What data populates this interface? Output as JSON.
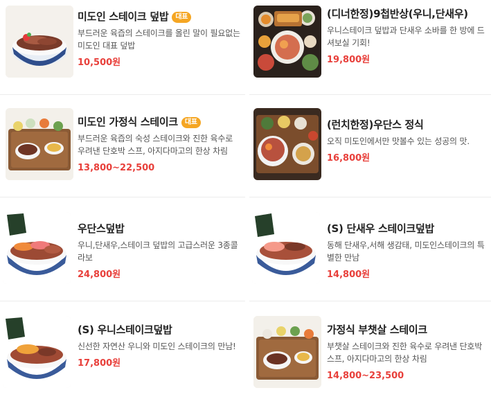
{
  "menu": {
    "items": [
      {
        "title": "미도인 스테이크 덮밥",
        "badge": "대표",
        "description": "부드러운 육즙의 스테이크를 올린 말이 필요없는 미도인 대표 덮밥",
        "price": "10,500원",
        "image": "steak-bowl"
      },
      {
        "title": "(디너한정)9첩반상(우니,단새우)",
        "badge": "",
        "description": "우니스테이크 덮밥과 단새우 소바를 한 방에 드셔보실 기회!",
        "price": "19,800원",
        "image": "nine-dish-set"
      },
      {
        "title": "미도인 가정식 스테이크",
        "badge": "대표",
        "description": "부드러운 육즙의 숙성 스테이크와 진한 육수로 우려낸 단호박 스프, 아지다마고의 한상 차림",
        "price": "13,800~22,500",
        "image": "home-steak-set"
      },
      {
        "title": "(런치한정)우단스 정식",
        "badge": "",
        "description": "오직 미도인에서만 맛볼수 있는 성공의 맛.",
        "price": "16,800원",
        "image": "udans-set"
      },
      {
        "title": "우단스덮밥",
        "badge": "",
        "description": "우니,단새우,스테이크 덮밥의 고급스러운 3종콜라보",
        "price": "24,800원",
        "image": "udans-bowl"
      },
      {
        "title": "(S) 단새우 스테이크덮밥",
        "badge": "",
        "description": "동해 단새우,서해 생감태, 미도인스테이크의 특별한 만남",
        "price": "14,800원",
        "image": "shrimp-steak-bowl"
      },
      {
        "title": "(S) 우니스테이크덮밥",
        "badge": "",
        "description": "신선한 자연산 우니와 미도인 스테이크의 만남!",
        "price": "17,800원",
        "image": "uni-steak-bowl"
      },
      {
        "title": "가정식 부챗살 스테이크",
        "badge": "",
        "description": "부챗살 스테이크와 진한 육수로 우려낸 단호박 스프, 아지다마고의 한상 차림",
        "price": "14,800~23,500",
        "image": "flatiron-steak-set"
      }
    ]
  }
}
